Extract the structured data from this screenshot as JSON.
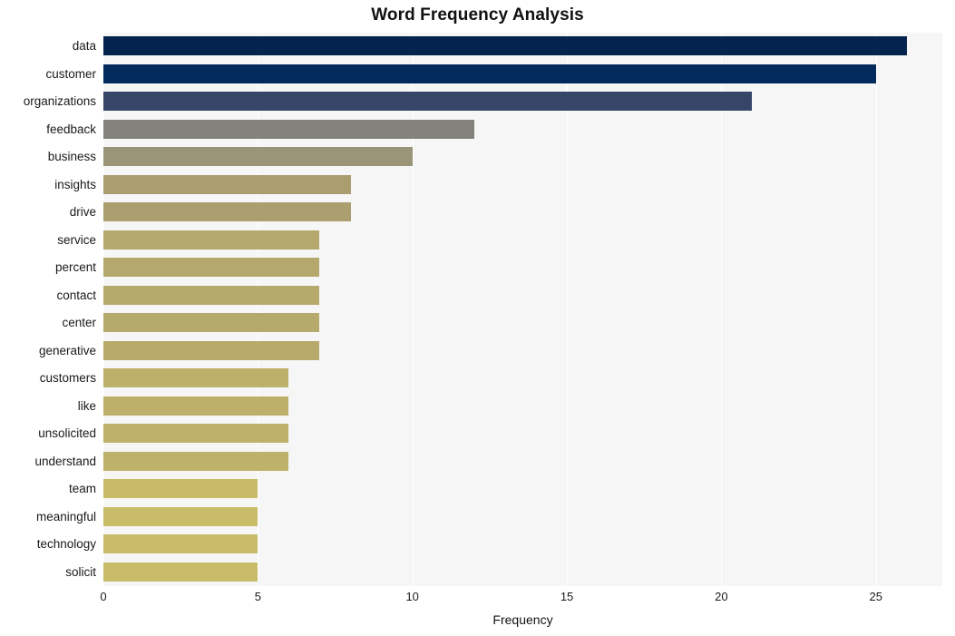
{
  "chart_data": {
    "type": "bar",
    "orientation": "horizontal",
    "title": "Word Frequency Analysis",
    "xlabel": "Frequency",
    "ylabel": "",
    "xlim": [
      0,
      27.15
    ],
    "xticks": [
      0,
      5,
      10,
      15,
      20,
      25
    ],
    "xtick_labels": [
      "0",
      "5",
      "10",
      "15",
      "20",
      "25"
    ],
    "grid": true,
    "grid_axis": "x",
    "legend": false,
    "plot_background": "#f6f6f6",
    "figure_background": "#ffffff",
    "categories": [
      "data",
      "customer",
      "organizations",
      "feedback",
      "business",
      "insights",
      "drive",
      "service",
      "percent",
      "contact",
      "center",
      "generative",
      "customers",
      "like",
      "unsolicited",
      "understand",
      "team",
      "meaningful",
      "technology",
      "solicit"
    ],
    "values": [
      26,
      25,
      21,
      12,
      10,
      8,
      8,
      7,
      7,
      7,
      7,
      7,
      6,
      6,
      6,
      6,
      5,
      5,
      5,
      5
    ],
    "bar_colors": [
      "#042450",
      "#032a5c",
      "#374569",
      "#83827c",
      "#9a9579",
      "#aa9e70",
      "#ab9f70",
      "#b5a86c",
      "#b5a86c",
      "#b6a96c",
      "#b6a96c",
      "#b7aa6b",
      "#bdb06a",
      "#bdb06a",
      "#beb169",
      "#beb169",
      "#c8bb68",
      "#c9bc68",
      "#c9bc68",
      "#c9bc68"
    ]
  }
}
